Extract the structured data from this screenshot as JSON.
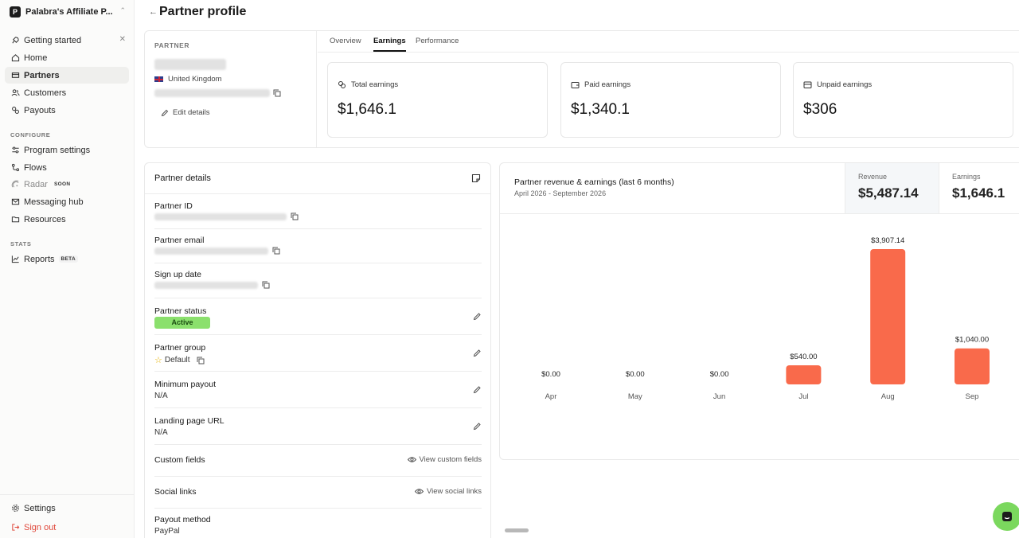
{
  "workspace": {
    "name": "Palabra's Affiliate P...",
    "logo_letter": "P"
  },
  "sidebar": {
    "items": [
      {
        "label": "Getting started",
        "icon": "rocket-icon"
      },
      {
        "label": "Home",
        "icon": "home-icon"
      },
      {
        "label": "Partners",
        "icon": "partners-icon"
      },
      {
        "label": "Customers",
        "icon": "users-icon"
      },
      {
        "label": "Payouts",
        "icon": "payouts-icon"
      }
    ],
    "configure_label": "CONFIGURE",
    "configure_items": [
      {
        "label": "Program settings",
        "icon": "sliders-icon"
      },
      {
        "label": "Flows",
        "icon": "flows-icon"
      },
      {
        "label": "Radar",
        "badge": "SOON",
        "icon": "radar-icon"
      },
      {
        "label": "Messaging hub",
        "icon": "mail-icon"
      },
      {
        "label": "Resources",
        "icon": "folder-icon"
      }
    ],
    "stats_label": "STATS",
    "stats_items": [
      {
        "label": "Reports",
        "badge": "BETA",
        "icon": "chart-line-icon"
      }
    ],
    "settings_label": "Settings",
    "signout_label": "Sign out"
  },
  "header": {
    "title": "Partner profile"
  },
  "partner": {
    "section_label": "PARTNER",
    "country": "United Kingdom",
    "edit_label": "Edit details"
  },
  "tabs": [
    "Overview",
    "Earnings",
    "Performance"
  ],
  "stats": [
    {
      "label": "Total earnings",
      "value": "$1,646.1",
      "icon": "coins-icon"
    },
    {
      "label": "Paid earnings",
      "value": "$1,340.1",
      "icon": "wallet-icon"
    },
    {
      "label": "Unpaid earnings",
      "value": "$306",
      "icon": "inbox-icon"
    }
  ],
  "details": {
    "title": "Partner details",
    "partner_id_label": "Partner ID",
    "partner_email_label": "Partner email",
    "signup_label": "Sign up date",
    "status_label": "Partner status",
    "status_value": "Active",
    "group_label": "Partner group",
    "group_value": "Default",
    "min_payout_label": "Minimum payout",
    "min_payout_value": "N/A",
    "landing_label": "Landing page URL",
    "landing_value": "N/A",
    "custom_fields_label": "Custom fields",
    "custom_fields_link": "View custom fields",
    "social_label": "Social links",
    "social_link": "View social links",
    "payout_method_label": "Payout method",
    "payout_method_value": "PayPal"
  },
  "chart_header": {
    "title": "Partner revenue & earnings (last 6 months)",
    "subtitle": "April 2026 - September 2026",
    "revenue_label": "Revenue",
    "revenue_value": "$5,487.14",
    "earnings_label": "Earnings",
    "earnings_value": "$1,646.1"
  },
  "colors": {
    "bar": "#f96a4b",
    "active_badge": "#8be06d",
    "signout": "#e0483b"
  },
  "chart_data": {
    "type": "bar",
    "categories": [
      "Apr",
      "May",
      "Jun",
      "Jul",
      "Aug",
      "Sep"
    ],
    "values": [
      0,
      0,
      0,
      540,
      3907.14,
      1040
    ],
    "labels": [
      "$0.00",
      "$0.00",
      "$0.00",
      "$540.00",
      "$3,907.14",
      "$1,040.00"
    ],
    "ylim": [
      0,
      3907.14
    ],
    "grid": false,
    "color": "#f96a4b"
  }
}
